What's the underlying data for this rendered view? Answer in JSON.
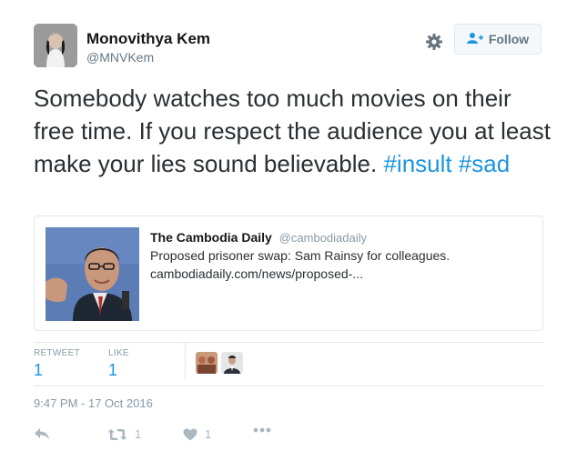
{
  "user": {
    "name": "Monovithya Kem",
    "handle": "@MNVKem"
  },
  "follow_label": "Follow",
  "tweet": {
    "text": "Somebody watches too much movies on their free time. If you respect the audience you at least make your lies sound believable.",
    "hashtags": [
      "#insult",
      "#sad"
    ]
  },
  "card": {
    "source_name": "The Cambodia Daily",
    "source_handle": "@cambodiadaily",
    "title": "Proposed prisoner swap: Sam Rainsy for colleagues.",
    "url": "cambodiadaily.com/news/proposed-..."
  },
  "stats": {
    "retweet_label": "RETWEET",
    "retweet_count": "1",
    "like_label": "LIKE",
    "like_count": "1"
  },
  "timestamp": "9:47 PM - 17 Oct 2016",
  "actions": {
    "retweet_count": "1",
    "like_count": "1"
  },
  "colors": {
    "link": "#1b95e0",
    "muted": "#8899a6",
    "border": "#e1e8ed"
  }
}
